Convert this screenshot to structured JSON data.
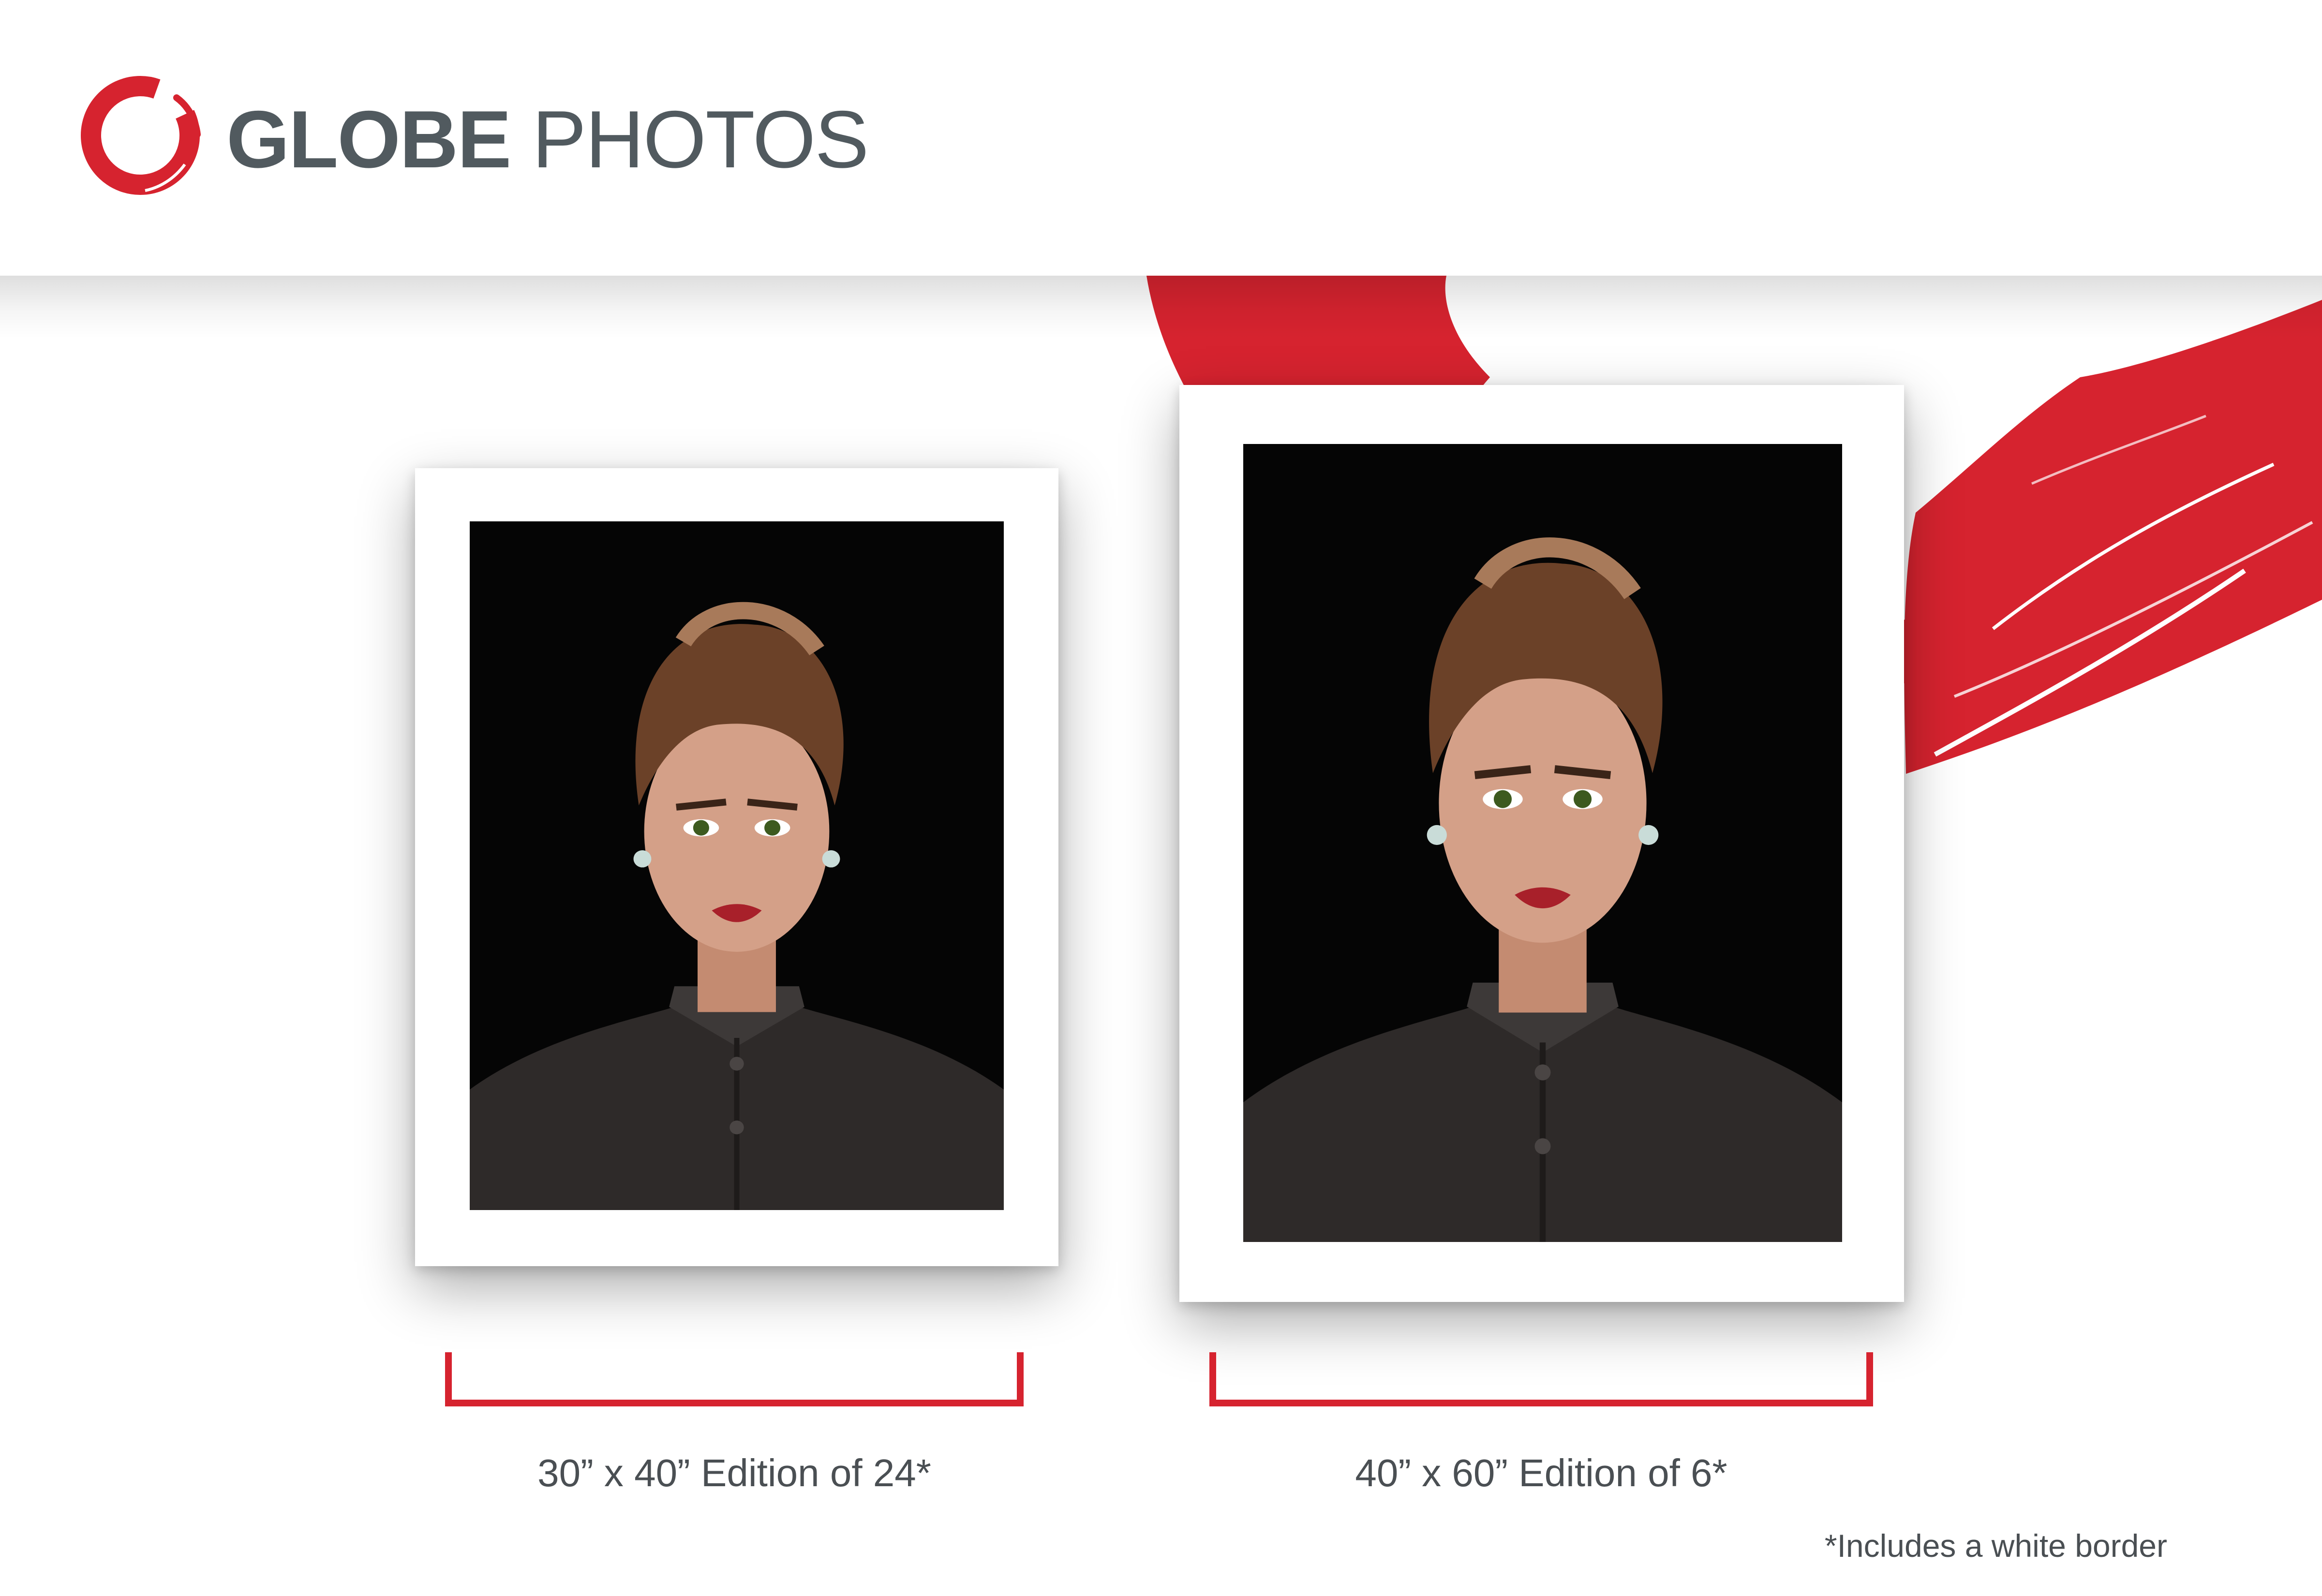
{
  "brand": {
    "bold": "GLOBE",
    "light": "PHOTOS"
  },
  "colors": {
    "accent": "#d6232f",
    "text": "#4a4f53",
    "brand_text": "#515a5f",
    "photo_background": "#050505"
  },
  "prints": [
    {
      "size": "30” x 40”",
      "edition": "Edition of 24*",
      "caption": "30” x 40” Edition of 24*"
    },
    {
      "size": "40” x 60”",
      "edition": "Edition of 6*",
      "caption": "40” x 60” Edition of 6*"
    }
  ],
  "footnote": "*Includes a white border"
}
